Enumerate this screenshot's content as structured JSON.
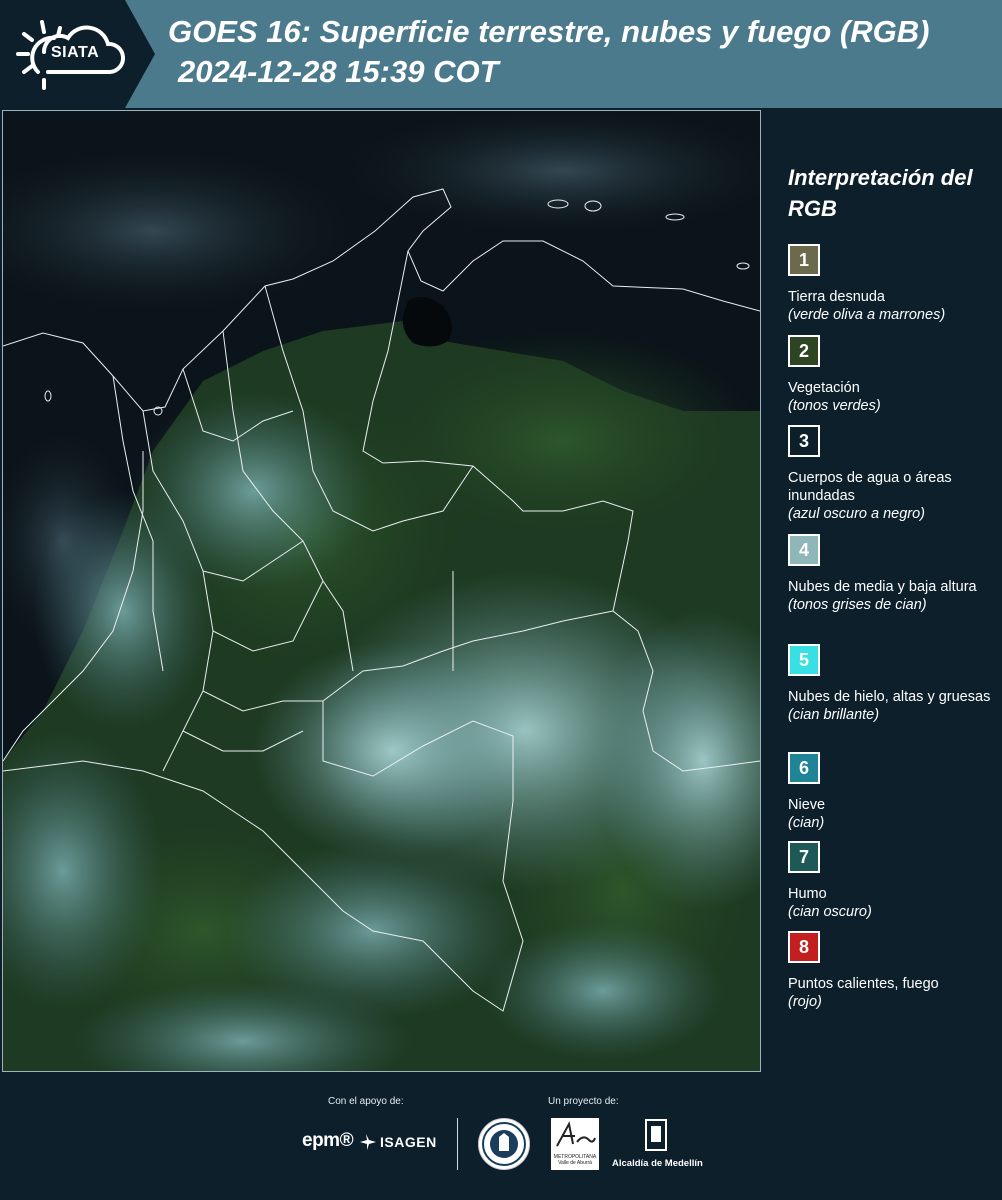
{
  "header": {
    "logo_text": "SIATA",
    "title_line1": "GOES 16: Superficie terrestre, nubes y fuego (RGB)",
    "title_line2": "2024-12-28 15:39 COT"
  },
  "map": {
    "icon": "satellite-image-colombia-map"
  },
  "legend": {
    "title": "Interpretación del RGB",
    "items": [
      {
        "number": "1",
        "color": "#6b6a4c",
        "label": "Tierra desnuda",
        "desc": "(verde oliva a marrones)"
      },
      {
        "number": "2",
        "color": "#2e4524",
        "label": "Vegetación",
        "desc": "(tonos verdes)"
      },
      {
        "number": "3",
        "color": "#0c1f2b",
        "label": "Cuerpos de agua o áreas inundadas",
        "desc": "(azul oscuro a negro)"
      },
      {
        "number": "4",
        "color": "#8fb7b9",
        "label": "Nubes de media y baja altura",
        "desc": "(tonos grises de cian)"
      },
      {
        "number": "5",
        "color": "#39e0e3",
        "label": "Nubes de hielo, altas y gruesas",
        "desc": "(cian brillante)"
      },
      {
        "number": "6",
        "color": "#1f8596",
        "label": "Nieve",
        "desc": "(cian)"
      },
      {
        "number": "7",
        "color": "#1d5957",
        "label": "Humo",
        "desc": "(cian oscuro)"
      },
      {
        "number": "8",
        "color": "#c41f1f",
        "label": "Puntos calientes, fuego",
        "desc": "(rojo)"
      }
    ]
  },
  "footer": {
    "support_label": "Con el apoyo de:",
    "project_label": "Un proyecto de:",
    "epm": "epm®",
    "isagen": "ISAGEN",
    "area_metropolitana": "METROPOLITANA Valle de Aburrá",
    "alcaldia": "Alcaldía de Medellín"
  },
  "colors": {
    "background": "#0c1f2b",
    "header": "#4b7a8c"
  }
}
